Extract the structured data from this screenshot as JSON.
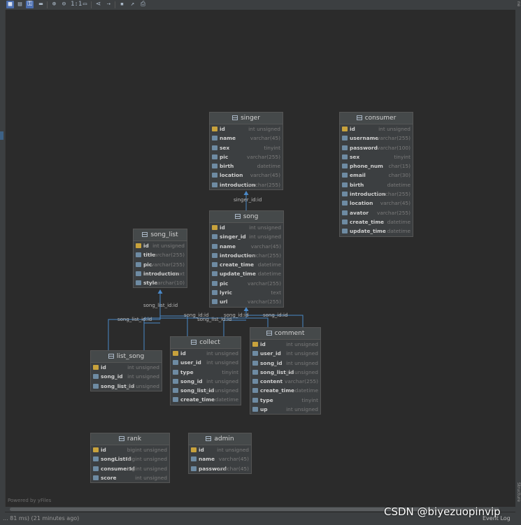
{
  "tables": [
    {
      "id": "singer",
      "title": "singer",
      "columns": [
        {
          "name": "id",
          "type": "int unsigned",
          "key": true
        },
        {
          "name": "name",
          "type": "varchar(45)"
        },
        {
          "name": "sex",
          "type": "tinyint"
        },
        {
          "name": "pic",
          "type": "varchar(255)"
        },
        {
          "name": "birth",
          "type": "datetime"
        },
        {
          "name": "location",
          "type": "varchar(45)"
        },
        {
          "name": "introduction",
          "type": "varchar(255)"
        }
      ]
    },
    {
      "id": "consumer",
      "title": "consumer",
      "columns": [
        {
          "name": "id",
          "type": "int unsigned",
          "key": true
        },
        {
          "name": "username",
          "type": "varchar(255)"
        },
        {
          "name": "password",
          "type": "varchar(100)"
        },
        {
          "name": "sex",
          "type": "tinyint"
        },
        {
          "name": "phone_num",
          "type": "char(15)"
        },
        {
          "name": "email",
          "type": "char(30)"
        },
        {
          "name": "birth",
          "type": "datetime"
        },
        {
          "name": "introduction",
          "type": "varchar(255)"
        },
        {
          "name": "location",
          "type": "varchar(45)"
        },
        {
          "name": "avator",
          "type": "varchar(255)"
        },
        {
          "name": "create_time",
          "type": "datetime"
        },
        {
          "name": "update_time",
          "type": "datetime"
        }
      ]
    },
    {
      "id": "song",
      "title": "song",
      "columns": [
        {
          "name": "id",
          "type": "int unsigned",
          "key": true
        },
        {
          "name": "singer_id",
          "type": "int unsigned"
        },
        {
          "name": "name",
          "type": "varchar(45)"
        },
        {
          "name": "introduction",
          "type": "varchar(255)"
        },
        {
          "name": "create_time",
          "type": "datetime"
        },
        {
          "name": "update_time",
          "type": "datetime"
        },
        {
          "name": "pic",
          "type": "varchar(255)"
        },
        {
          "name": "lyric",
          "type": "text"
        },
        {
          "name": "url",
          "type": "varchar(255)"
        }
      ]
    },
    {
      "id": "song_list",
      "title": "song_list",
      "columns": [
        {
          "name": "id",
          "type": "int unsigned",
          "key": true
        },
        {
          "name": "title",
          "type": "varchar(255)"
        },
        {
          "name": "pic",
          "type": "varchar(255)"
        },
        {
          "name": "introduction",
          "type": "text"
        },
        {
          "name": "style",
          "type": "varchar(10)"
        }
      ]
    },
    {
      "id": "list_song",
      "title": "list_song",
      "columns": [
        {
          "name": "id",
          "type": "int unsigned",
          "key": true
        },
        {
          "name": "song_id",
          "type": "int unsigned"
        },
        {
          "name": "song_list_id",
          "type": "int unsigned"
        }
      ]
    },
    {
      "id": "collect",
      "title": "collect",
      "columns": [
        {
          "name": "id",
          "type": "int unsigned",
          "key": true
        },
        {
          "name": "user_id",
          "type": "int unsigned"
        },
        {
          "name": "type",
          "type": "tinyint"
        },
        {
          "name": "song_id",
          "type": "int unsigned"
        },
        {
          "name": "song_list_id",
          "type": "int unsigned"
        },
        {
          "name": "create_time",
          "type": "datetime"
        }
      ]
    },
    {
      "id": "comment",
      "title": "comment",
      "columns": [
        {
          "name": "id",
          "type": "int unsigned",
          "key": true
        },
        {
          "name": "user_id",
          "type": "int unsigned"
        },
        {
          "name": "song_id",
          "type": "int unsigned"
        },
        {
          "name": "song_list_id",
          "type": "int unsigned"
        },
        {
          "name": "content",
          "type": "varchar(255)"
        },
        {
          "name": "create_time",
          "type": "datetime"
        },
        {
          "name": "type",
          "type": "tinyint"
        },
        {
          "name": "up",
          "type": "int unsigned"
        }
      ]
    },
    {
      "id": "rank",
      "title": "rank",
      "columns": [
        {
          "name": "id",
          "type": "bigint unsigned",
          "key": true
        },
        {
          "name": "songListId",
          "type": "bigint unsigned"
        },
        {
          "name": "consumerId",
          "type": "bigint unsigned"
        },
        {
          "name": "score",
          "type": "int unsigned"
        }
      ]
    },
    {
      "id": "admin",
      "title": "admin",
      "columns": [
        {
          "name": "id",
          "type": "int unsigned",
          "key": true
        },
        {
          "name": "name",
          "type": "varchar(45)"
        },
        {
          "name": "password",
          "type": "varchar(45)"
        }
      ]
    }
  ],
  "edge_labels": {
    "singer_song": "singer_id:id",
    "song_list_id_top": "song_list_id:id",
    "song_list_id_left": "song_list_id:id",
    "song_id_1": "song_id:id",
    "song_list_id_mid": "song_list_id:id",
    "song_id_2": "song_id:id",
    "song_id_3": "song_id:id"
  },
  "footer": {
    "powered": "Powered by yFiles",
    "status": "... 81 ms) (21 minutes ago)",
    "event_log": "Event Log",
    "watermark": "CSDN @biyezuopinvip",
    "structure": "Structure"
  },
  "toolbar_icons": [
    "select-icon",
    "table-icon",
    "key-icon",
    "note-icon",
    "zoom-in-icon",
    "zoom-out-icon",
    "actual-size-icon",
    "fit-icon",
    "share-icon",
    "layout-icon",
    "save-icon",
    "export-icon",
    "print-icon"
  ],
  "colors": {
    "background": "#2b2b2b",
    "table": "#3c3f41",
    "edge": "#4a88c7",
    "key_icon": "#c8a23c"
  }
}
